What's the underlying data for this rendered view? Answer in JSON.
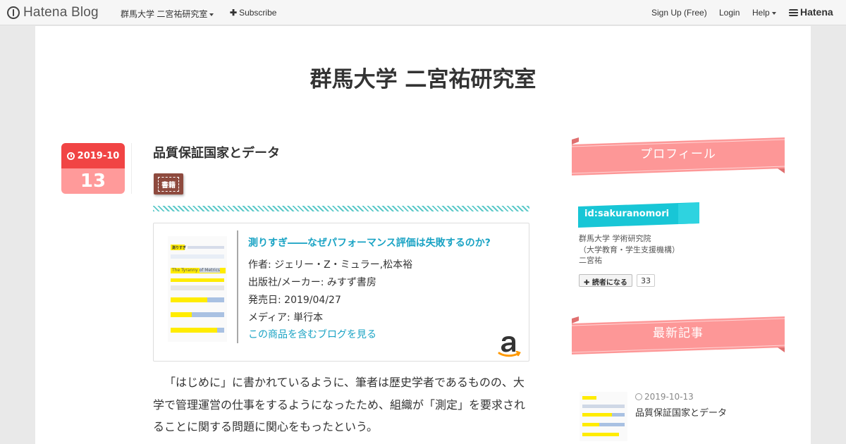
{
  "topbar": {
    "logo_text": "Hatena Blog",
    "blog_menu": "群馬大学 二宮祐研究室",
    "subscribe": "Subscribe",
    "signup": "Sign Up (Free)",
    "login": "Login",
    "help": "Help",
    "hatena": "Hatena"
  },
  "blog": {
    "title": "群馬大学 二宮祐研究室"
  },
  "entry": {
    "date_ym": "2019-10",
    "date_day": "13",
    "title": "品質保証国家とデータ",
    "category": "書籍",
    "product": {
      "title": "測りすぎ――なぜパフォーマンス評価は失敗するのか?",
      "author": "作者: ジェリー・Z・ミュラー,松本裕",
      "publisher": "出版社/メーカー: みすず書房",
      "release": "発売日: 2019/04/27",
      "media": "メディア: 単行本",
      "blog_link": "この商品を含むブログを見る",
      "cover_title_jp": "測りすぎ",
      "cover_title_en_a": "The Tyranny",
      "cover_title_en_b": "of Metrics"
    },
    "body_lines": [
      "「はじめに」に書かれているように、筆者は歴史学者であるものの、大",
      "学で管理運営の仕事をするようになったため、組織が「測定」を要求され",
      "ることに関する問題に関心をもったという。"
    ]
  },
  "sidebar": {
    "profile_heading": "プロフィール",
    "profile_id": "id:sakuranomori",
    "profile_lines": [
      "群馬大学 学術研究院",
      "（大学教育・学生支援機構）",
      "二宮祐"
    ],
    "reader_button": "読者になる",
    "reader_count": "33",
    "recent_heading": "最新記事",
    "recent": {
      "date": "2019-10-13",
      "title": "品質保証国家とデータ"
    }
  },
  "colors": {
    "accent_red": "#f14444",
    "accent_pink": "#ff9a9a",
    "ribbon": "#fd9797",
    "link_teal": "#1aa3c4",
    "id_cyan": "#18c6d6",
    "category_brown": "#8e4a3e"
  }
}
